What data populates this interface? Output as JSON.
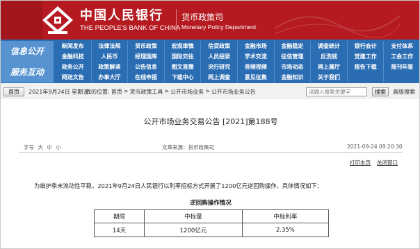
{
  "header": {
    "bank_name_cn": "中国人民银行",
    "bank_name_en": "THE PEOPLE'S BANK OF CHINA",
    "dept_cn": "货币政策司",
    "dept_en": "Monetary Policy Department"
  },
  "nav": {
    "row1_label": "信息公开",
    "row2_label": "服务互动",
    "row1_items": [
      "新闻发布",
      "法律法规",
      "货币政策",
      "宏观审慎",
      "信贷政策",
      "金融市场",
      "金融稳定",
      "调查统计",
      "银行会计",
      "支付体系",
      "金融科技",
      "人民币",
      "经理国库",
      "国际交往",
      "人员招录",
      "学术交流",
      "征信管理",
      "反洗钱",
      "党建工作",
      "工会工作"
    ],
    "row2_items": [
      "政务公开",
      "政策解读",
      "公告信息",
      "图文直播",
      "央行研究",
      "音频视频",
      "市场动态",
      "网上展厅",
      "报告下载",
      "报刊年鉴",
      "网送文告",
      "办事大厅",
      "在线申报",
      "下载中心",
      "网上调查",
      "意见征集",
      "金融知识",
      "关于我们",
      "",
      ""
    ]
  },
  "toolbar": {
    "home_button": "首页",
    "date_text": "2021年9月24日 星期五",
    "location_prefix": "我的位置:",
    "breadcrumb": [
      "首页",
      "货币政策工具",
      "公开市场业务",
      "公开市场业务公告"
    ],
    "separator": ">",
    "search_placeholder": "请输入搜索关键字",
    "search_button": "搜索",
    "advanced_search": "高级搜索"
  },
  "article": {
    "title": "公开市场业务交易公告 [2021]第188号",
    "font_size_label": "字号",
    "font_sizes": [
      "大",
      "中",
      "小"
    ],
    "source": "文章来源：货币政策司",
    "datetime": "2021-09-24 09:20:30",
    "print_label": "打印本页",
    "close_label": "关闭窗口",
    "paragraph": "为维护季末流动性平稳，2021年9月24日人民银行以利率招标方式开展了1200亿元逆回购操作。具体情况如下：",
    "table_caption": "逆回购操作情况",
    "table": {
      "headers": [
        "期限",
        "中标量",
        "中标利率"
      ],
      "rows": [
        [
          "14天",
          "1200亿元",
          "2.35%"
        ]
      ]
    }
  },
  "colors": {
    "banner_red": "#b51a20",
    "nav_blue": "#2a6db3",
    "nav_label_blue": "#5793d0"
  }
}
